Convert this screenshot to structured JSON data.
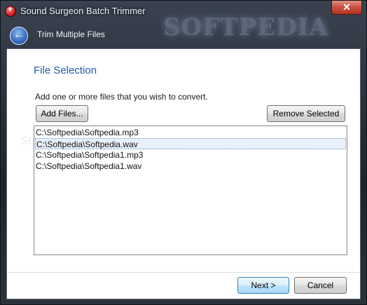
{
  "window": {
    "title": "Sound Surgeon Batch Trimmer",
    "close_label": "✕",
    "watermark": "SOFTPEDIA"
  },
  "header": {
    "back_label": "←",
    "title": "Trim Multiple Files"
  },
  "main": {
    "section_title": "File Selection",
    "description": "Add one or more files that you wish to convert.",
    "add_files_label": "Add Files...",
    "remove_selected_label": "Remove Selected",
    "ghost_watermark": "SOFTPEDIA",
    "files": [
      "C:\\Softpedia\\Softpedia.mp3",
      "C:\\Softpedia\\Softpedia.wav",
      "C:\\Softpedia\\Softpedia1.mp3",
      "C:\\Softpedia\\Softpedia1.wav"
    ],
    "selected_index": 1
  },
  "footer": {
    "next_label": "Next >",
    "cancel_label": "Cancel"
  }
}
